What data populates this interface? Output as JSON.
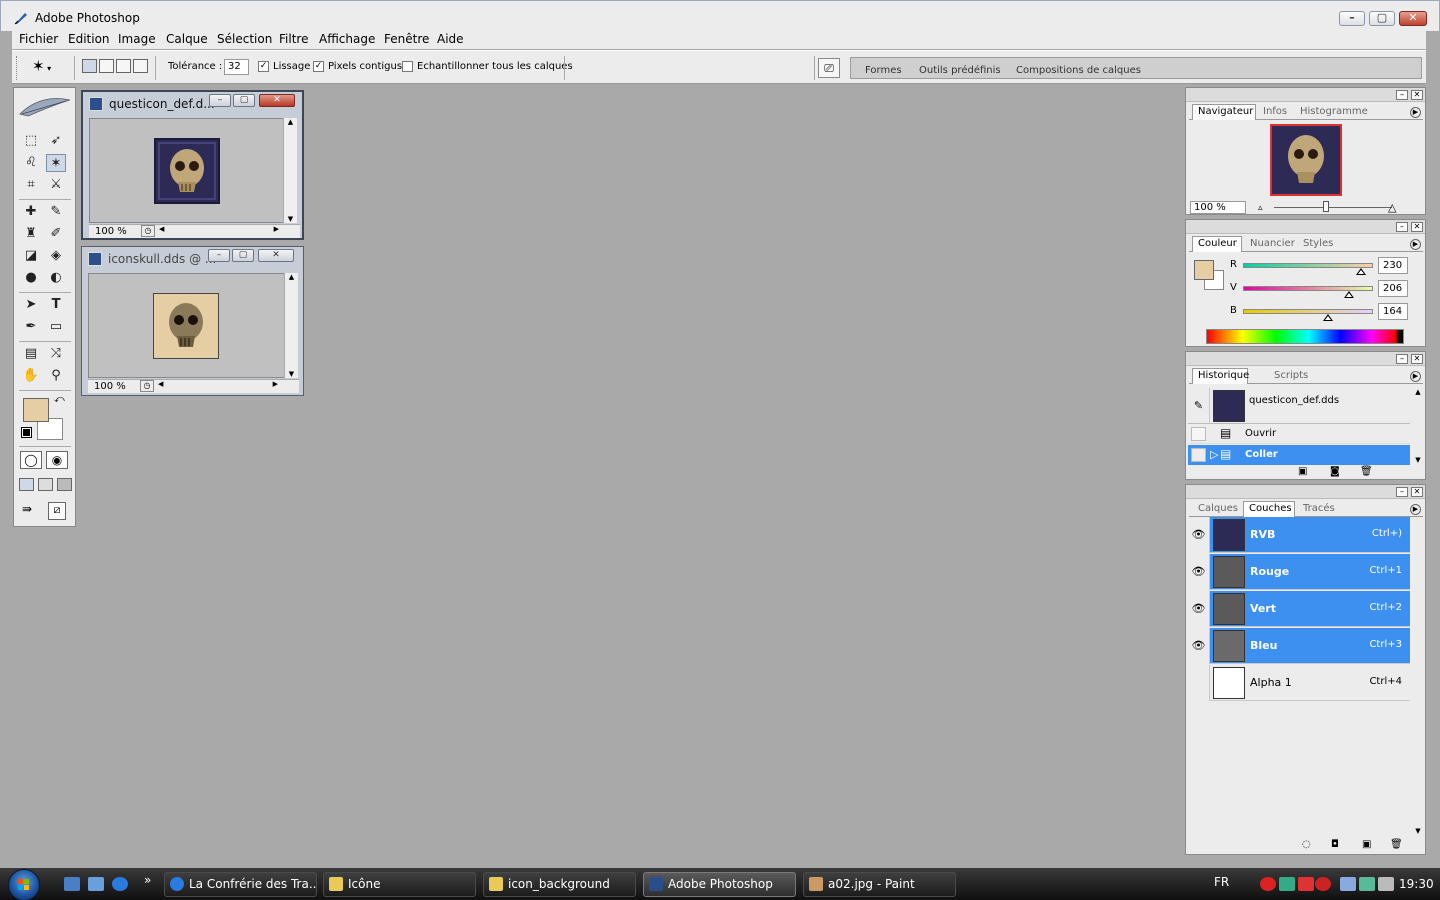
{
  "window": {
    "title": "Adobe Photoshop",
    "min": "–",
    "max": "▢",
    "close": "✕"
  },
  "menu": [
    "Fichier",
    "Edition",
    "Image",
    "Calque",
    "Sélection",
    "Filtre",
    "Affichage",
    "Fenêtre",
    "Aide"
  ],
  "options": {
    "tolerance_label": "Tolérance :",
    "tolerance_value": "32",
    "lissage": "Lissage",
    "pixels_contigus": "Pixels contigus",
    "echantillonner": "Echantillonner tous les calques",
    "lissage_checked": "✓",
    "pixels_checked": "✓",
    "well_tabs": [
      "Formes",
      "Outils prédéfinis",
      "Compositions de calques"
    ]
  },
  "doc1": {
    "title": "questicon_def.d...",
    "zoom": "100 %"
  },
  "doc2": {
    "title": "iconskull.dds @ ...",
    "zoom": "100 %"
  },
  "navigator": {
    "tabs": [
      "Navigateur",
      "Infos",
      "Histogramme"
    ],
    "zoom": "100 %"
  },
  "color": {
    "tabs": [
      "Couleur",
      "Nuancier",
      "Styles"
    ],
    "r_label": "R",
    "v_label": "V",
    "b_label": "B",
    "r": 230,
    "v": 206,
    "b": 164,
    "r_str": "230",
    "v_str": "206",
    "b_str": "164",
    "foreground": "#e6cea4"
  },
  "history": {
    "tabs": [
      "Historique",
      "Scripts"
    ],
    "snapshot": "questicon_def.dds",
    "items": [
      "Ouvrir",
      "Coller"
    ]
  },
  "channels": {
    "tabs": [
      "Calques",
      "Couches",
      "Tracés"
    ],
    "rows": [
      {
        "name": "RVB",
        "shortcut": "Ctrl+)"
      },
      {
        "name": "Rouge",
        "shortcut": "Ctrl+1"
      },
      {
        "name": "Vert",
        "shortcut": "Ctrl+2"
      },
      {
        "name": "Bleu",
        "shortcut": "Ctrl+3"
      },
      {
        "name": "Alpha 1",
        "shortcut": "Ctrl+4"
      }
    ]
  },
  "taskbar": {
    "more": "»",
    "items": [
      "La Confrérie des Tra...",
      "Icône",
      "icon_background",
      "Adobe Photoshop",
      "a02.jpg - Paint"
    ],
    "lang": "FR",
    "time": "19:30"
  },
  "icons": {
    "eye": "👁",
    "history_brush": "✎"
  }
}
